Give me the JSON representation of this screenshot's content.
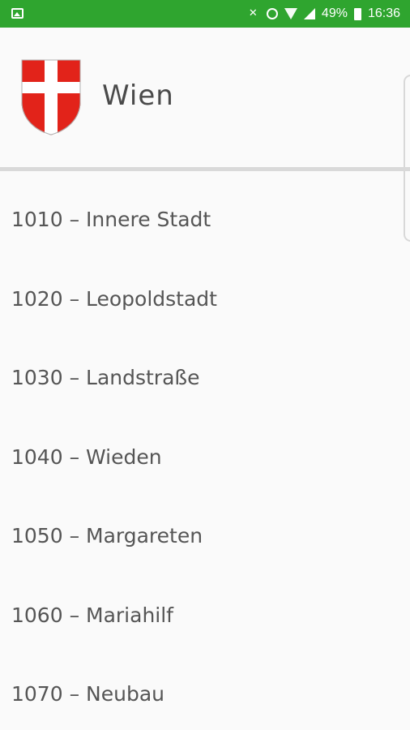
{
  "status_bar": {
    "battery_percent": "49%",
    "time": "16:36"
  },
  "header": {
    "title": "Wien",
    "colors": {
      "crest_red": "#e2231a",
      "crest_white": "#ffffff"
    }
  },
  "districts": [
    "1010 – Innere Stadt",
    "1020 – Leopoldstadt",
    "1030 – Landstraße",
    "1040 – Wieden",
    "1050 – Margareten",
    "1060 – Mariahilf",
    "1070 – Neubau"
  ]
}
